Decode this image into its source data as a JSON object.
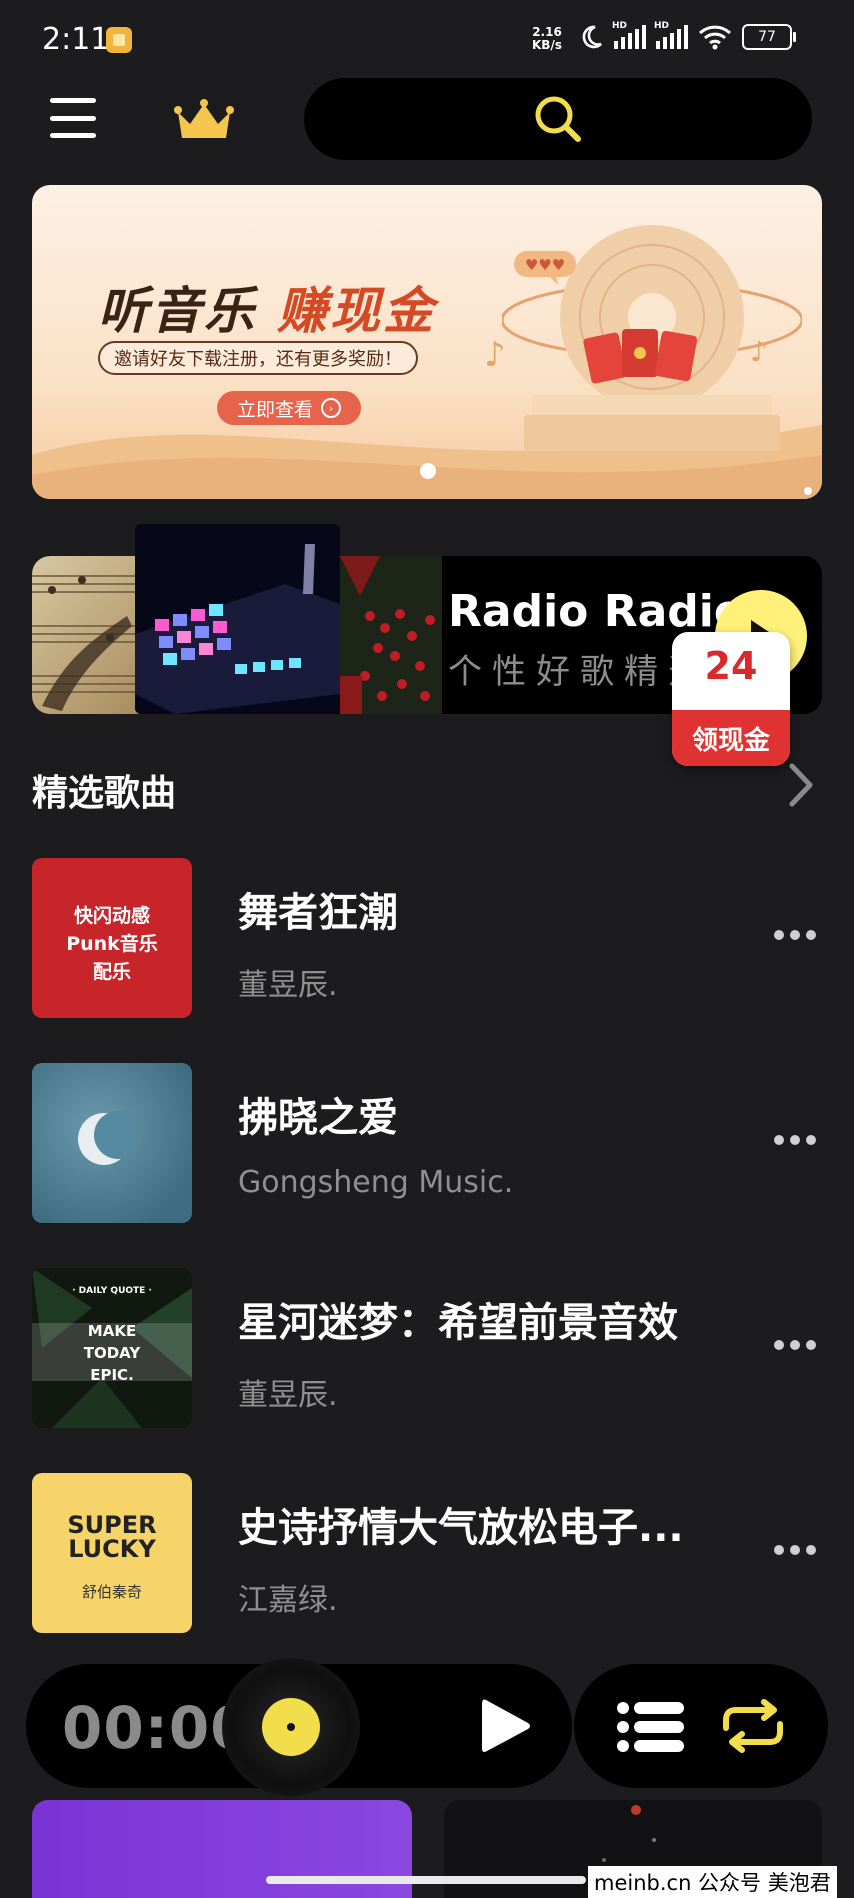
{
  "status_bar": {
    "time": "2:11",
    "speed_value": "2.16",
    "speed_unit": "KB/s",
    "signal1_tag": "HD",
    "signal2_tag": "HD",
    "battery": "77"
  },
  "top_bar": {
    "menu_icon": "menu-icon",
    "vip_icon": "crown-icon",
    "search_icon": "search-icon"
  },
  "banner": {
    "title_part1": "听音乐",
    "title_part2": "赚现金",
    "subtitle": "邀请好友下载注册，还有更多奖励！",
    "button_label": "立即查看",
    "colors": {
      "title_dark": "#3a2214",
      "title_accent": "#d44a24",
      "button": "#e7644c"
    }
  },
  "radio": {
    "title": "Radio Radio",
    "subtitle": "个性好歌精选",
    "reward": {
      "count": "24",
      "label": "领现金"
    }
  },
  "section": {
    "title": "精选歌曲"
  },
  "songs": [
    {
      "title": "舞者狂潮",
      "artist": "董昱辰.",
      "cover_line1": "快闪动感",
      "cover_line2": "Punk音乐",
      "cover_line3": "配乐"
    },
    {
      "title": "拂晓之爱",
      "artist": "Gongsheng Music."
    },
    {
      "title": "星河迷梦：希望前景音效",
      "artist": "董昱辰.",
      "cover_line0": "· DAILY QUOTE ·",
      "cover_line1": "MAKE",
      "cover_line2": "TODAY",
      "cover_line3": "EPIC."
    },
    {
      "title": "史诗抒情大气放松电子...",
      "artist": "江嘉绿.",
      "cover_line1": "SUPER",
      "cover_line2": "LUCKY",
      "cover_line3": "舒伯秦奇"
    }
  ],
  "player": {
    "time": "00:00",
    "accent": "#f2de4a"
  },
  "footer": {
    "watermark": "meinb.cn 公众号 美泡君"
  }
}
